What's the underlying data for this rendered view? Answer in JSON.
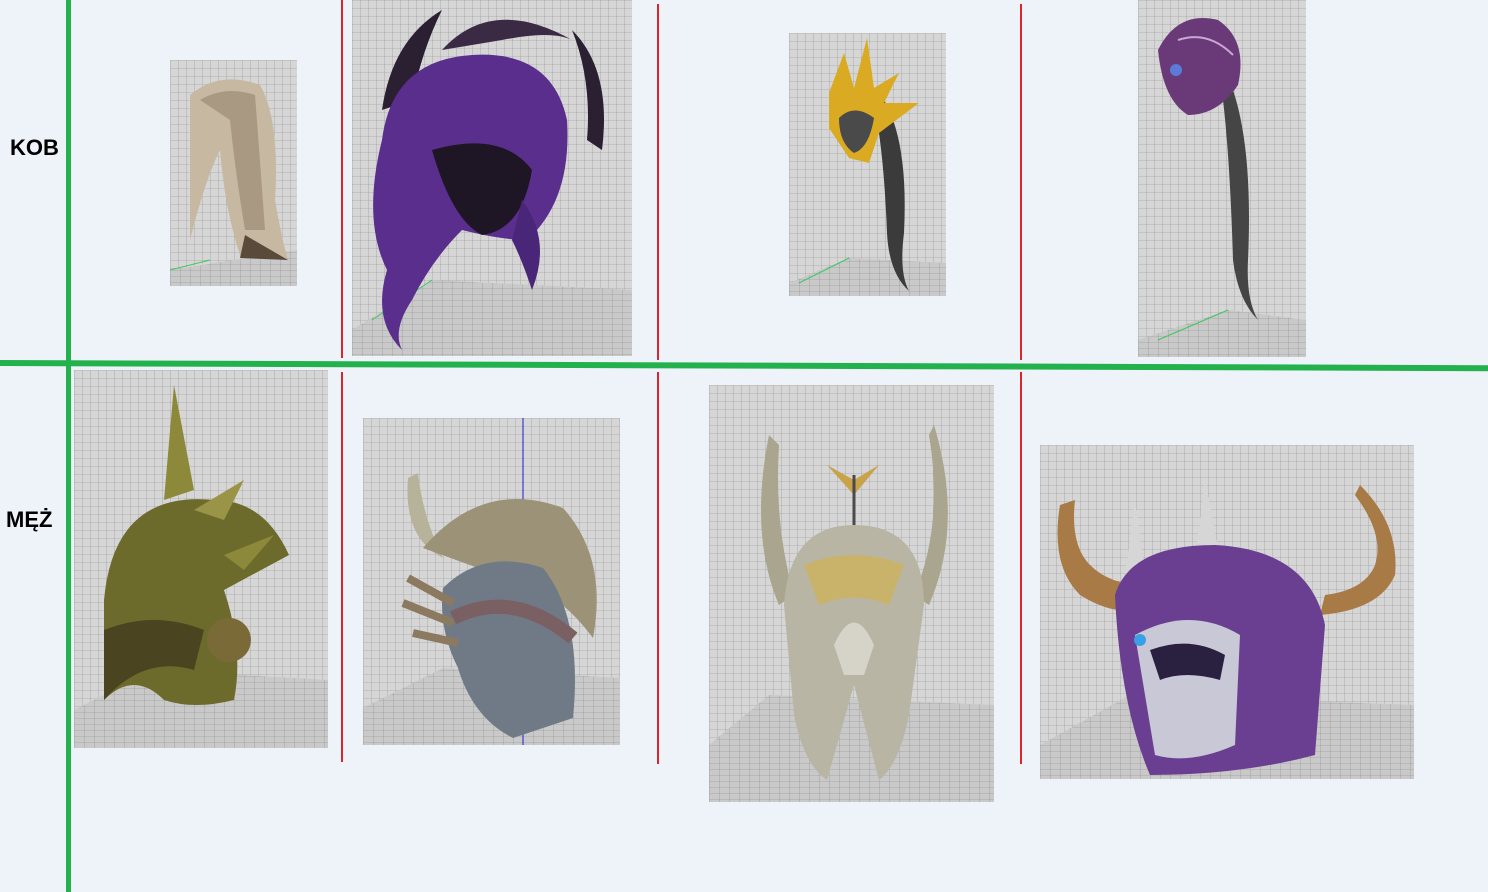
{
  "rows": {
    "female_label": "KOB",
    "male_label": "MĘŻ"
  },
  "thumbnails": {
    "female": [
      {
        "item": "blonde-hair",
        "icon": "long-hair"
      },
      {
        "item": "purple-horned-hair",
        "icon": "horned-hair"
      },
      {
        "item": "golden-crown-braid",
        "icon": "crown-braid"
      },
      {
        "item": "purple-helm-braid",
        "icon": "helm-braid"
      }
    ],
    "male": [
      {
        "item": "olive-spiked-helmet",
        "icon": "spiked-helmet"
      },
      {
        "item": "bone-horn-helmet",
        "icon": "horn-helmet"
      },
      {
        "item": "silver-winged-helmet",
        "icon": "winged-helmet"
      },
      {
        "item": "purple-horned-helmet",
        "icon": "horned-helmet"
      }
    ]
  },
  "colors": {
    "background": "#eef3fa",
    "divider_green": "#22b14c",
    "divider_red": "#d9252b",
    "grid_wall": "#d4d4d4",
    "grid_line": "#8a8a8a"
  }
}
